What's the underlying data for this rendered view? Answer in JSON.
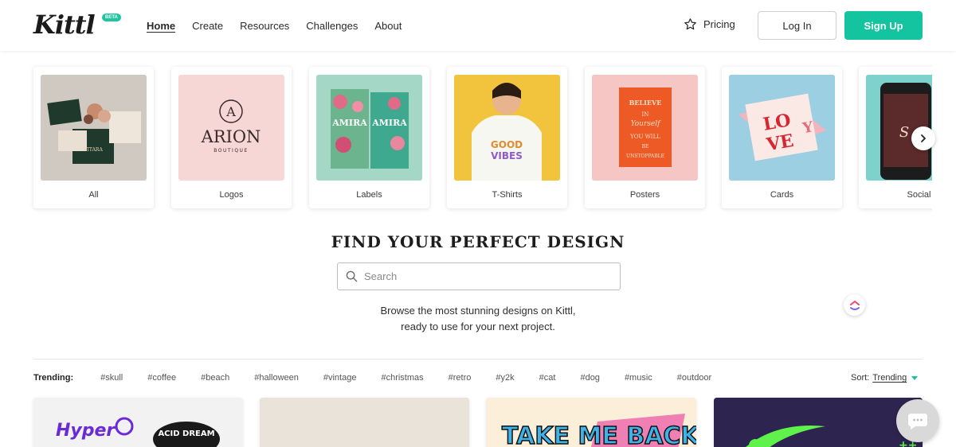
{
  "header": {
    "logo": "Kittl",
    "beta_badge": "BETA",
    "nav": [
      {
        "label": "Home",
        "active": true
      },
      {
        "label": "Create",
        "active": false
      },
      {
        "label": "Resources",
        "active": false
      },
      {
        "label": "Challenges",
        "active": false
      },
      {
        "label": "About",
        "active": false
      }
    ],
    "pricing_label": "Pricing",
    "login_label": "Log In",
    "signup_label": "Sign Up"
  },
  "categories": [
    {
      "label": "All",
      "thumb_bg": "#d9d5cf"
    },
    {
      "label": "Logos",
      "thumb_bg": "#f7d6d6",
      "thumb_text": "ARION",
      "thumb_subtext": "BOUTIQUE"
    },
    {
      "label": "Labels",
      "thumb_bg": "#a8d8c8",
      "thumb_text": "AMIRA"
    },
    {
      "label": "T-Shirts",
      "thumb_bg": "#f3c63f",
      "thumb_text": "GOOD VIBES"
    },
    {
      "label": "Posters",
      "thumb_bg": "#f6c7c5",
      "thumb_text": "BELIEVE IN YOURSELF"
    },
    {
      "label": "Cards",
      "thumb_bg": "#9ad0e4",
      "thumb_text": "LOVE YOU"
    },
    {
      "label": "Social",
      "thumb_bg": "#7fd3cf"
    }
  ],
  "hero": {
    "title": "FIND YOUR PERFECT DESIGN",
    "search_placeholder": "Search",
    "subtitle_line1": "Browse the most stunning designs on Kittl,",
    "subtitle_line2": "ready to use for your next project."
  },
  "trending": {
    "label": "Trending:",
    "tags": [
      "#skull",
      "#coffee",
      "#beach",
      "#halloween",
      "#vintage",
      "#christmas",
      "#retro",
      "#y2k",
      "#cat",
      "#dog",
      "#music",
      "#outdoor"
    ],
    "sort_label": "Sort:",
    "sort_value": "Trending"
  },
  "gallery": [
    {
      "bg": "#f2f2f2",
      "text1": "Hyper",
      "text2": "ACID DREAM"
    },
    {
      "bg": "#e9e3da"
    },
    {
      "bg": "#fbefd9",
      "text1": "TAKE ME BACK"
    },
    {
      "bg": "#3a2d5c"
    }
  ],
  "colors": {
    "accent": "#14c4a0",
    "text": "#1f1f1f"
  }
}
